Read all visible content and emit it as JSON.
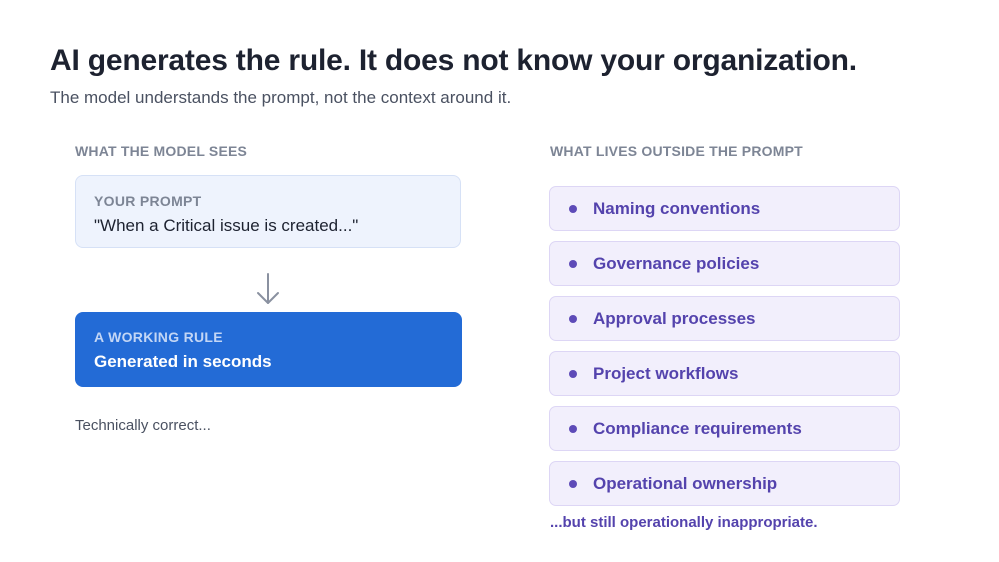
{
  "header": {
    "title": "AI generates the rule. It does not know your organization.",
    "subtitle": "The model understands the prompt, not the context around it."
  },
  "left": {
    "heading": "WHAT THE MODEL SEES",
    "prompt_box": {
      "label": "YOUR PROMPT",
      "text": "\"When a Critical issue is created...\""
    },
    "arrow_icon": "arrow-down-icon",
    "rule_box": {
      "label": "A WORKING RULE",
      "text": "Generated in seconds"
    },
    "note": "Technically correct..."
  },
  "right": {
    "heading": "WHAT LIVES OUTSIDE THE PROMPT",
    "items": [
      {
        "label": "Naming conventions"
      },
      {
        "label": "Governance policies"
      },
      {
        "label": "Approval processes"
      },
      {
        "label": "Project workflows"
      },
      {
        "label": "Compliance requirements"
      },
      {
        "label": "Operational ownership"
      }
    ],
    "note": "...but still operationally inappropriate."
  },
  "colors": {
    "rule_box": "#236bd6",
    "prompt_box": "#eef3fd",
    "context_item_bg": "#f2effc",
    "context_text": "#5443ad",
    "title": "#1d2230"
  }
}
